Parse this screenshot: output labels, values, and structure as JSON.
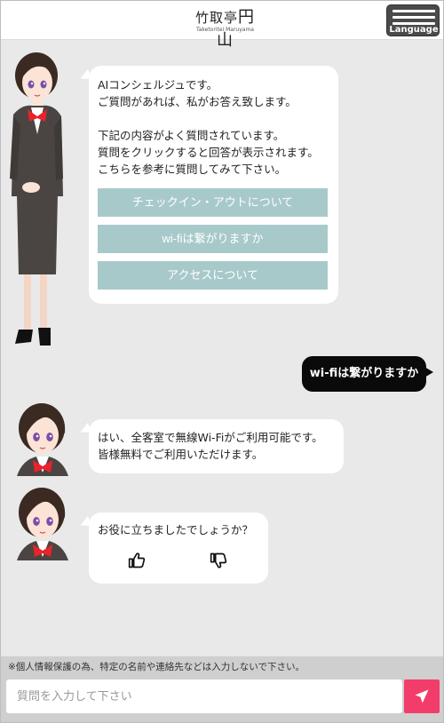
{
  "header": {
    "logo_text": "竹取亭",
    "logo_mark": "円山",
    "logo_sub": "Taketoritei Maruyama",
    "language_label": "Language"
  },
  "chat": {
    "intro": {
      "lines": [
        "AIコンシェルジュです。",
        "ご質問があれば、私がお答え致します。",
        "",
        "下記の内容がよく質問されています。",
        "質問をクリックすると回答が表示されます。",
        "こちらを参考に質問してみて下さい。"
      ],
      "choices": [
        "チェックイン・アウトについて",
        "wi-fiは繋がりますか",
        "アクセスについて"
      ]
    },
    "user_message": "wi-fiは繋がりますか",
    "answer": {
      "lines": [
        "はい、全客室で無線Wi-Fiがご利用可能です。",
        "皆様無料でご利用いただけます。"
      ]
    },
    "feedback": {
      "question": "お役に立ちましたでしょうか？",
      "icons": [
        "thumbs-up-icon",
        "thumbs-down-icon"
      ]
    }
  },
  "footer": {
    "notice": "※個人情報保護の為、特定の名前や連絡先などは入力しないで下さい。",
    "input_placeholder": "質問を入力して下さい",
    "send_icon": "send-icon"
  },
  "colors": {
    "background": "#e9e9e9",
    "choice_button": "#a8c9c9",
    "user_bubble": "#0a0a0a",
    "send_button": "#f23d6a"
  }
}
